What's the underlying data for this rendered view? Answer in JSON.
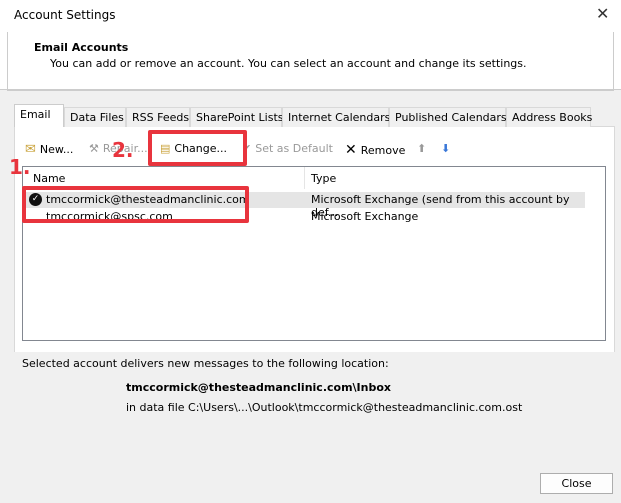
{
  "window": {
    "title": "Account Settings",
    "close_icon": "close-icon"
  },
  "header": {
    "title": "Email Accounts",
    "subtitle": "You can add or remove an account. You can select an account and change its settings."
  },
  "tabs": [
    {
      "label": "Email",
      "active": true
    },
    {
      "label": "Data Files"
    },
    {
      "label": "RSS Feeds"
    },
    {
      "label": "SharePoint Lists"
    },
    {
      "label": "Internet Calendars"
    },
    {
      "label": "Published Calendars"
    },
    {
      "label": "Address Books"
    }
  ],
  "toolbar": {
    "new": "New...",
    "repair": "Repair...",
    "change": "Change...",
    "set_default": "Set as Default",
    "remove": "Remove"
  },
  "list": {
    "columns": [
      "Name",
      "Type"
    ],
    "rows": [
      {
        "name": "tmccormick@thesteadmanclinic.com",
        "type": "Microsoft Exchange (send from this account by def...",
        "selected": true,
        "default": true
      },
      {
        "name": "tmccormick@spsc.com",
        "type": "Microsoft Exchange"
      }
    ]
  },
  "annotations": {
    "step1": "1.",
    "step2": "2."
  },
  "delivery": {
    "label": "Selected account delivers new messages to the following location:",
    "folder": "tmccormick@thesteadmanclinic.com\\Inbox",
    "file": "in data file C:\\Users\\...\\Outlook\\tmccormick@thesteadmanclinic.com.ost"
  },
  "footer": {
    "close": "Close"
  },
  "colors": {
    "highlight": "#e8343d",
    "selected_row": "#e5e5e5"
  }
}
